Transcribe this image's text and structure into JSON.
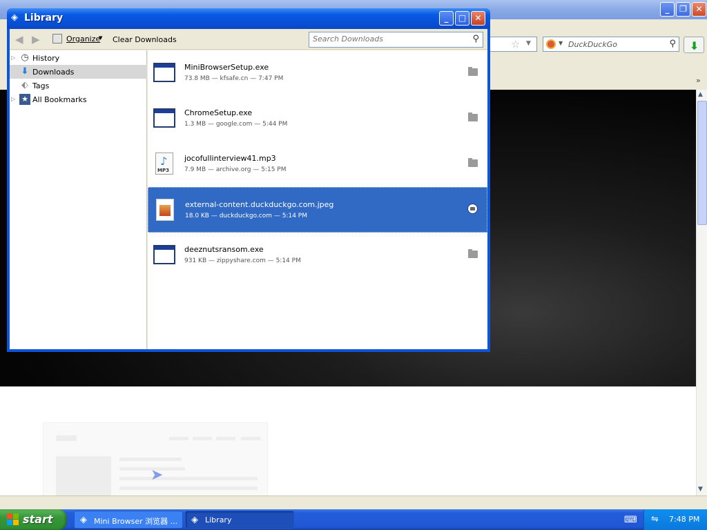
{
  "browser": {
    "title": "",
    "search_placeholder": "DuckDuckGo"
  },
  "library": {
    "title": "Library",
    "toolbar": {
      "organize_label": "Organize",
      "clear_label": "Clear Downloads",
      "search_placeholder": "Search Downloads"
    },
    "sidebar": [
      {
        "label": "History",
        "icon": "history-icon",
        "has_children": true,
        "selected": false
      },
      {
        "label": "Downloads",
        "icon": "download-arrow-icon",
        "has_children": false,
        "selected": true
      },
      {
        "label": "Tags",
        "icon": "tag-icon",
        "has_children": false,
        "selected": false
      },
      {
        "label": "All Bookmarks",
        "icon": "bookmark-star-icon",
        "has_children": true,
        "selected": false
      }
    ],
    "downloads": [
      {
        "name": "MiniBrowserSetup.exe",
        "meta": "73.8 MB — kfsafe.cn — 7:47 PM",
        "icon": "executable-icon",
        "selected": false
      },
      {
        "name": "ChromeSetup.exe",
        "meta": "1.3 MB — google.com — 5:44 PM",
        "icon": "executable-icon",
        "selected": false
      },
      {
        "name": "jocofullinterview41.mp3",
        "meta": "7.9 MB — archive.org — 5:15 PM",
        "icon": "mp3-file-icon",
        "selected": false
      },
      {
        "name": "external-content.duckduckgo.com.jpeg",
        "meta": "18.0 KB — duckduckgo.com — 5:14 PM",
        "icon": "image-file-icon",
        "selected": true
      },
      {
        "name": "deeznutsransom.exe",
        "meta": "931 KB — zippyshare.com — 5:14 PM",
        "icon": "executable-icon",
        "selected": false
      }
    ]
  },
  "taskbar": {
    "start_label": "start",
    "tasks": [
      {
        "label": "Mini Browser 浏览器 ...",
        "active": false
      },
      {
        "label": "Library",
        "active": true
      }
    ],
    "clock": "7:48 PM"
  },
  "colors": {
    "selection": "#316ac5",
    "xp_title_blue": "#0a5ae4",
    "start_green": "#37963a"
  }
}
